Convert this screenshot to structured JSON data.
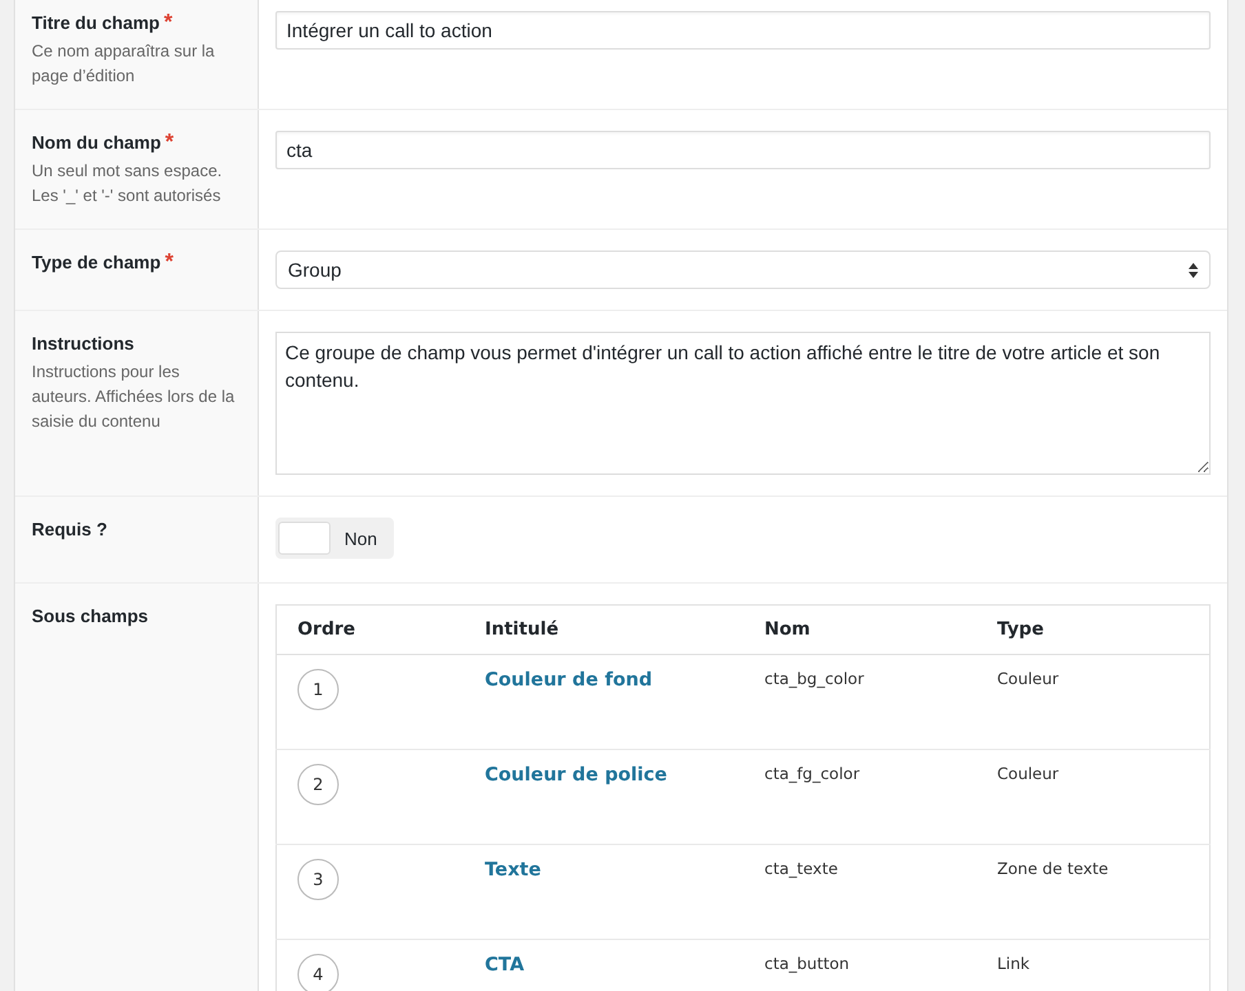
{
  "fields": [
    {
      "kind": "text",
      "label": "Titre du champ",
      "mark": "*",
      "description": "Ce nom apparaîtra sur la page d’édition",
      "value": "Intégrer un call to action"
    },
    {
      "kind": "text",
      "label": "Nom du champ",
      "mark": "*",
      "description": "Un seul mot sans espace. Les '_' et '-' sont autorisés",
      "value": "cta"
    },
    {
      "kind": "select",
      "label": "Type de champ",
      "mark": "*",
      "value": "Group"
    },
    {
      "kind": "textarea",
      "label": "Instructions",
      "description": "Instructions pour les auteurs. Affichées lors de la saisie du contenu",
      "value": "Ce groupe de champ vous permet d'intégrer un call to action affiché entre le titre de votre article et son contenu."
    },
    {
      "kind": "toggle",
      "label": "Requis ?",
      "on": false,
      "state_label": "Non"
    },
    {
      "kind": "subfields",
      "label": "Sous champs",
      "columns": [
        "Ordre",
        "Intitulé",
        "Nom",
        "Type"
      ],
      "rows": [
        {
          "order": "1",
          "label": "Couleur de fond",
          "name": "cta_bg_color",
          "type": "Couleur"
        },
        {
          "order": "2",
          "label": "Couleur de police",
          "name": "cta_fg_color",
          "type": "Couleur"
        },
        {
          "order": "3",
          "label": "Texte",
          "name": "cta_texte",
          "type": "Zone de texte"
        },
        {
          "order": "4",
          "label": "CTA",
          "name": "cta_button",
          "type": "Link"
        }
      ]
    }
  ]
}
